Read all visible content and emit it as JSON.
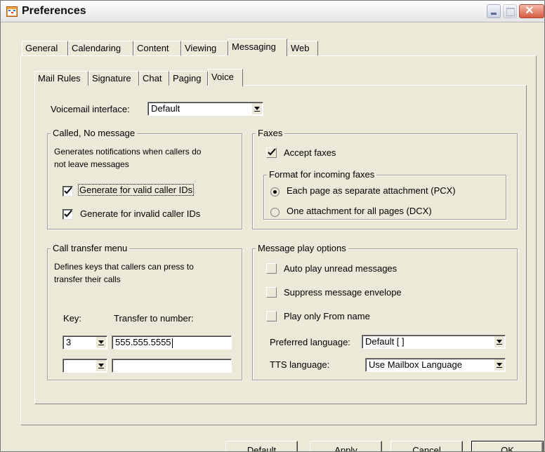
{
  "window": {
    "title": "Preferences"
  },
  "tabs": [
    "General",
    "Calendaring",
    "Content",
    "Viewing",
    "Messaging",
    "Web"
  ],
  "active_tab": "Messaging",
  "subtabs": [
    "Mail Rules",
    "Signature",
    "Chat",
    "Paging",
    "Voice"
  ],
  "active_subtab": "Voice",
  "voicemail": {
    "label": "Voicemail interface:",
    "value": "Default"
  },
  "called_no_message": {
    "legend": "Called, No message",
    "description_line1": "Generates notifications when callers do",
    "description_line2": "not leave messages",
    "valid_label": "Generate for valid caller IDs",
    "valid_checked": true,
    "invalid_label": "Generate for invalid caller IDs",
    "invalid_checked": true
  },
  "faxes": {
    "legend": "Faxes",
    "accept_label": "Accept faxes",
    "accept_checked": true,
    "format_legend": "Format for incoming faxes",
    "option_pcx": "Each page as separate attachment (PCX)",
    "option_dcx": "One attachment for all pages (DCX)",
    "selected": "pcx"
  },
  "call_transfer": {
    "legend": "Call transfer menu",
    "description_line1": "Defines keys that callers can press to",
    "description_line2": "transfer their calls",
    "key_header": "Key:",
    "number_header": "Transfer to number:",
    "rows": [
      {
        "key": "3",
        "number": "555.555.5555"
      },
      {
        "key": "",
        "number": ""
      }
    ]
  },
  "play_options": {
    "legend": "Message play options",
    "auto_play_label": "Auto play unread messages",
    "suppress_label": "Suppress message envelope",
    "from_name_label": "Play only From name",
    "preferred_language_label": "Preferred language:",
    "preferred_language_value": "Default [ ]",
    "tts_language_label": "TTS language:",
    "tts_language_value": "Use Mailbox Language"
  },
  "buttons": {
    "default": "Default",
    "apply": "Apply",
    "cancel": "Cancel",
    "ok": "OK"
  }
}
